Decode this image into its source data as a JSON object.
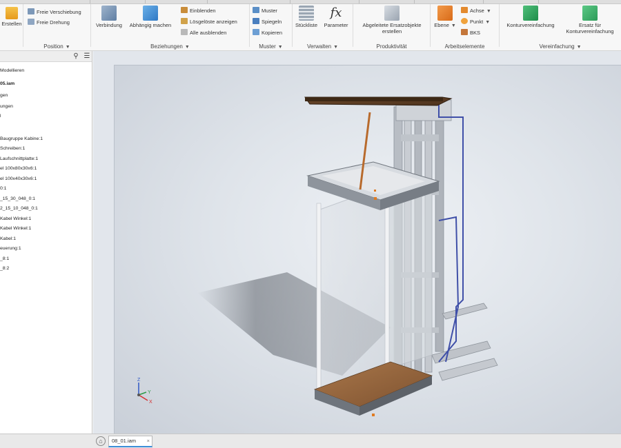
{
  "ribbon": {
    "panels": {
      "position": {
        "title": "Position",
        "free_move": "Freie Verschiebung",
        "free_rotate": "Freie Drehung"
      },
      "create": {
        "label": "Erstellen"
      },
      "relationships": {
        "title": "Beziehungen",
        "joint": "Verbindung",
        "constrain": "Abhängig machen",
        "show": "Einblenden",
        "show_sick": "Lösgelöste anzeigen",
        "hide_all": "Alle ausblenden"
      },
      "pattern": {
        "title": "Muster",
        "pattern": "Muster",
        "mirror": "Spiegeln",
        "copy": "Kopieren"
      },
      "manage": {
        "title": "Verwalten",
        "bom": "Stückliste",
        "parameters": "Parameter"
      },
      "productivity": {
        "title": "Produktivität",
        "replace": "Abgeleitete Ersatzobjekte erstellen"
      },
      "work_features": {
        "title": "Arbeitselemente",
        "plane": "Ebene",
        "axis": "Achse",
        "point": "Punkt",
        "ucs": "BKS"
      },
      "simplification": {
        "title": "Vereinfachung",
        "shrinkwrap": "Konturvereinfachung",
        "shrinkwrap_sub": "Ersatz für Konturvereinfachung"
      }
    }
  },
  "browser": {
    "tab_label": "Modellieren",
    "root": "05.iam",
    "items": [
      "gen",
      "ungen",
      "l",
      "Baugruppe Kabine:1",
      "Schreiben:1",
      "Laufschnittplatte:1",
      "el 100x80x30x6:1",
      "el 100x40x30x6:1",
      "0:1",
      "_15_30_048_0:1",
      "2_15_10_048_0:1",
      "Kabel Winkel:1",
      "Kabel Winkel:1",
      "Kabel:1",
      "euerung:1",
      "_8:1",
      "_8:2"
    ]
  },
  "viewport": {
    "axis_x": "X",
    "axis_y": "Y",
    "axis_z": "Z"
  },
  "doctabs": {
    "active": "08_01.iam"
  },
  "icons": {
    "search": "search-icon",
    "home": "home-icon",
    "close": "close-icon"
  }
}
